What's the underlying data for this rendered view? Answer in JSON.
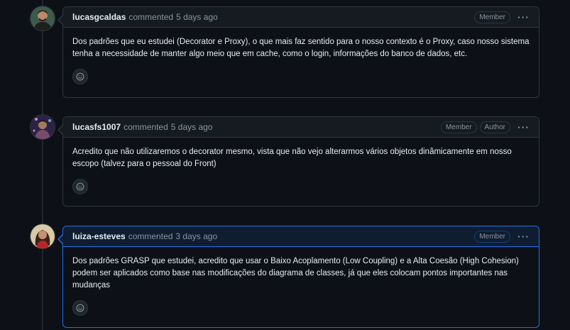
{
  "comments": [
    {
      "author": "lucasgcaldas",
      "action": "commented",
      "time": "5 days ago",
      "badges": [
        "Member"
      ],
      "body": "Dos padrões que eu estudei (Decorator e Proxy), o que mais faz sentido para o nosso contexto é o Proxy, caso nosso sistema tenha a necessidade de manter algo meio que em cache, como o login, informações do banco de dados, etc.",
      "avatar_icon": "user-avatar-icon"
    },
    {
      "author": "lucasfs1007",
      "action": "commented",
      "time": "5 days ago",
      "badges": [
        "Member",
        "Author"
      ],
      "body": "Acredito que não utilizaremos o decorator mesmo, vista que não vejo alterarmos vários objetos dinâmicamente em nosso escopo (talvez para o pessoal do Front)",
      "avatar_icon": "user-avatar-icon"
    },
    {
      "author": "luiza-esteves",
      "action": "commented",
      "time": "3 days ago",
      "badges": [
        "Member"
      ],
      "body": "Dos padrões GRASP que estudei, acredito que usar o Baixo Acoplamento (Low Coupling) e a Alta Coesão (High Cohesion) podem ser aplicados como base nas modificações do diagrama de classes, já que eles colocam pontos importantes nas mudanças",
      "avatar_icon": "user-avatar-icon"
    }
  ],
  "icons": {
    "kebab": "kebab-horizontal-icon",
    "reaction": "smiley-icon"
  },
  "colors": {
    "background": "#0d1117",
    "header_bg": "#161b22",
    "border": "#30363d",
    "highlight_border": "#1f6feb",
    "text": "#e6edf3",
    "muted": "#8b949e"
  }
}
